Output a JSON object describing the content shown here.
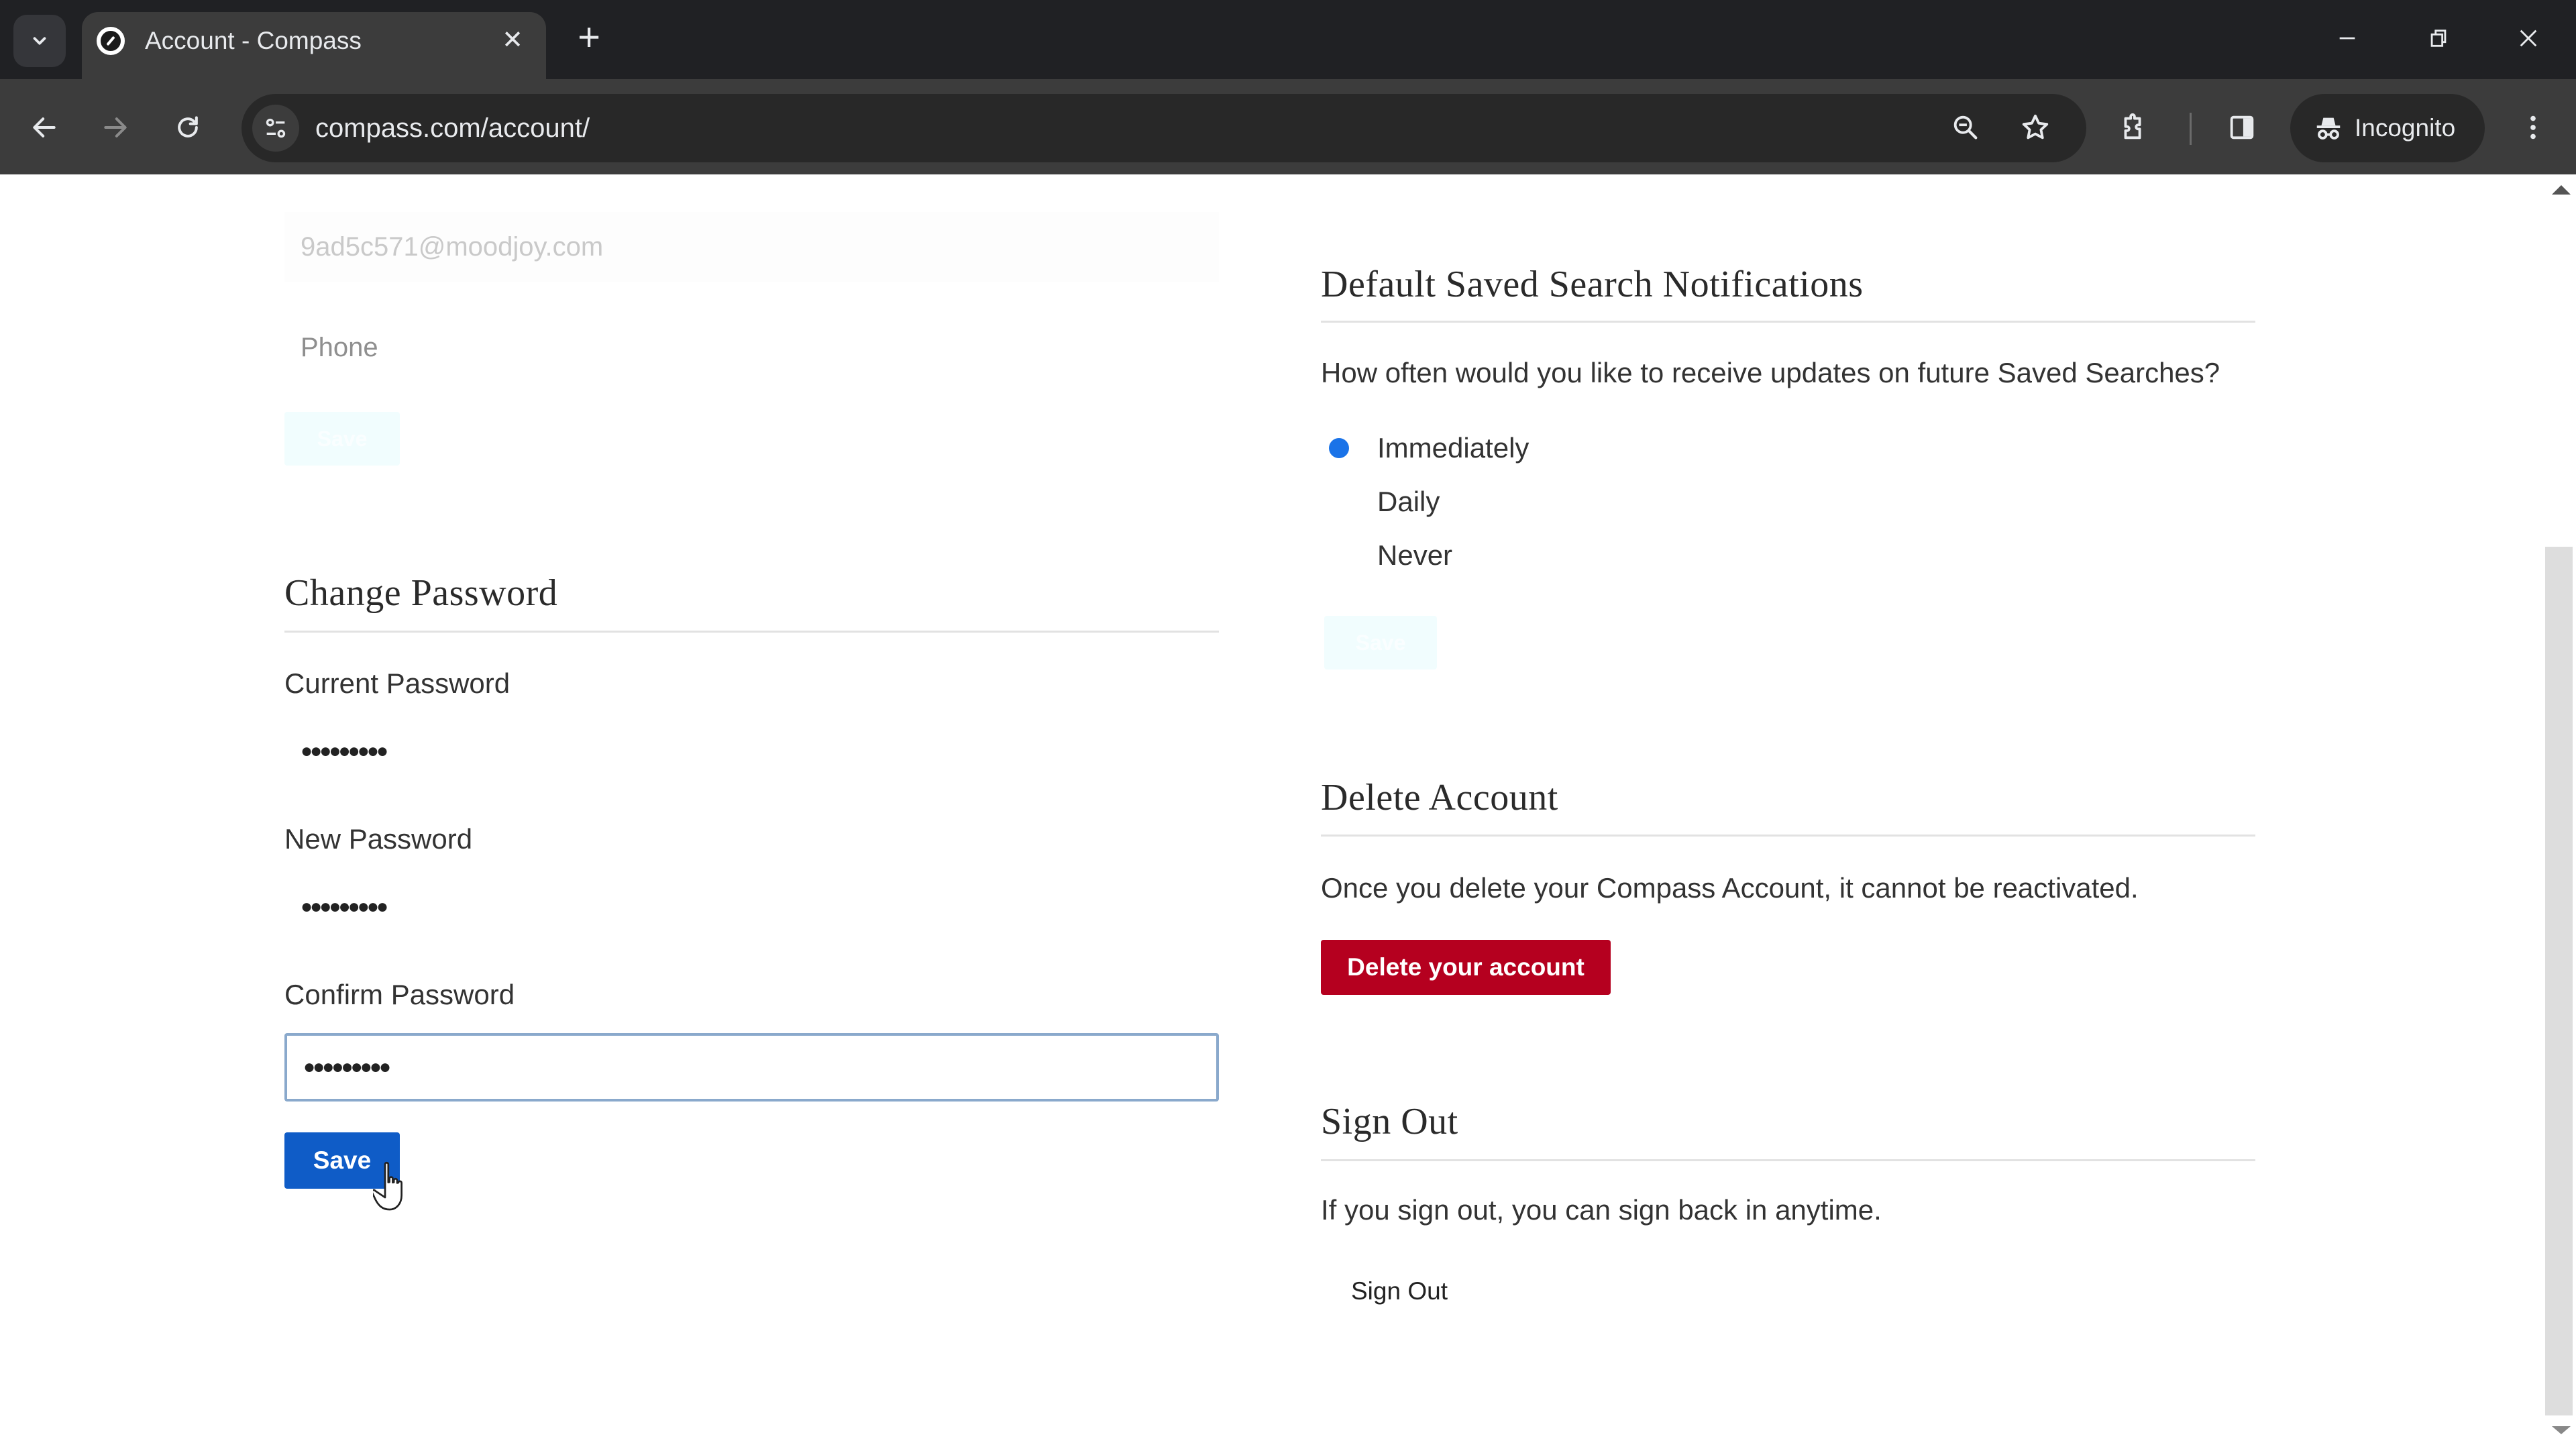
{
  "browser": {
    "tab_title": "Account - Compass",
    "url": "compass.com/account/",
    "profile_label": "Incognito",
    "icons": {
      "tab_search": "chevron-down-icon",
      "favicon": "compass-logo-icon",
      "tab_close": "close-icon",
      "new_tab": "plus-icon",
      "minimize": "minimize-icon",
      "restore": "restore-icon",
      "close": "close-icon",
      "back": "arrow-left-icon",
      "forward": "arrow-right-icon",
      "reload": "reload-icon",
      "site_info": "tune-icon",
      "zoom": "zoom-out-icon",
      "bookmark": "star-icon",
      "extensions": "puzzle-icon",
      "side_panel": "side-panel-icon",
      "incognito": "incognito-icon",
      "menu": "more-vert-icon"
    },
    "glyphs": {
      "tab_close": "✕",
      "new_tab": "+"
    }
  },
  "contact": {
    "email_value": "9ad5c571@moodjoy.com",
    "phone_placeholder": "Phone",
    "save_label": "Save"
  },
  "change_password": {
    "heading": "Change Password",
    "current_label": "Current Password",
    "current_value": "●●●●●●●●●",
    "new_label": "New Password",
    "new_value": "●●●●●●●●●",
    "confirm_label": "Confirm Password",
    "confirm_value": "●●●●●●●●●",
    "save_label": "Save"
  },
  "notifications": {
    "heading": "Default Saved Search Notifications",
    "question": "How often would you like to receive updates on future Saved Searches?",
    "options": [
      {
        "label": "Immediately",
        "selected": true
      },
      {
        "label": "Daily",
        "selected": false
      },
      {
        "label": "Never",
        "selected": false
      }
    ],
    "save_label": "Save"
  },
  "delete_account": {
    "heading": "Delete Account",
    "description": "Once you delete your Compass Account, it cannot be reactivated.",
    "button_label": "Delete your account"
  },
  "sign_out": {
    "heading": "Sign Out",
    "description": "If you sign out, you can sign back in anytime.",
    "button_label": "Sign Out"
  },
  "colors": {
    "primary_blue": "#0f5cc7",
    "radio_selected": "#1a73e8",
    "danger_red": "#b5001f",
    "focus_border": "#8aa9cc"
  }
}
